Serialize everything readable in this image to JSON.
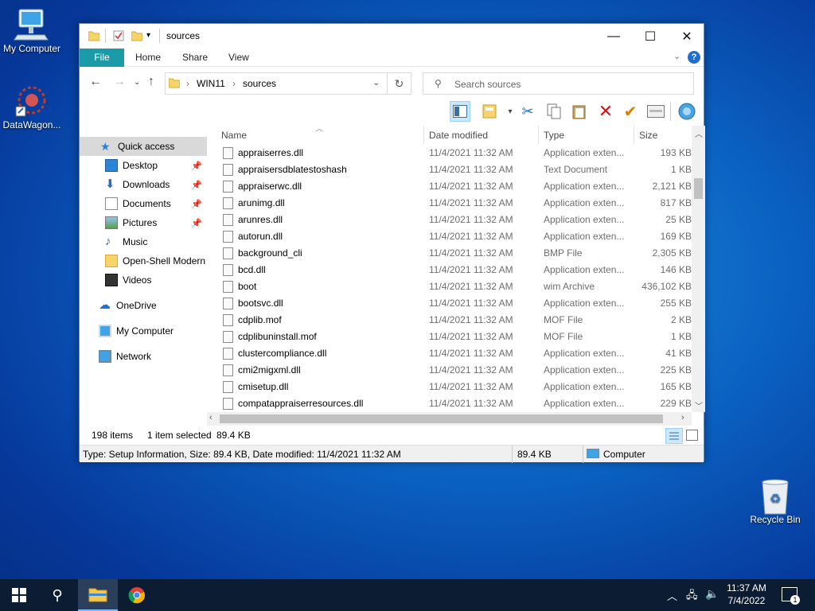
{
  "desktop": {
    "icons": [
      {
        "label": "My Computer"
      },
      {
        "label": "DataWagon..."
      },
      {
        "label": "Recycle Bin"
      }
    ]
  },
  "window": {
    "title": "sources",
    "ribbon_tabs": [
      "File",
      "Home",
      "Share",
      "View"
    ],
    "address": {
      "segments": [
        "WIN11",
        "sources"
      ]
    },
    "search": {
      "placeholder": "Search sources"
    },
    "nav": {
      "quick_access": "Quick access",
      "items": [
        {
          "label": "Desktop",
          "pinned": true
        },
        {
          "label": "Downloads",
          "pinned": true
        },
        {
          "label": "Documents",
          "pinned": true
        },
        {
          "label": "Pictures",
          "pinned": true
        },
        {
          "label": "Music",
          "pinned": false
        },
        {
          "label": "Open-Shell Modern",
          "pinned": false
        },
        {
          "label": "Videos",
          "pinned": false
        }
      ],
      "onedrive": "OneDrive",
      "mycomputer": "My Computer",
      "network": "Network"
    },
    "columns": [
      "Name",
      "Date modified",
      "Type",
      "Size"
    ],
    "files": [
      {
        "name": "appraiserres.dll",
        "date": "11/4/2021 11:32 AM",
        "type": "Application exten...",
        "size": "193 KB"
      },
      {
        "name": "appraisersdblatestoshash",
        "date": "11/4/2021 11:32 AM",
        "type": "Text Document",
        "size": "1 KB"
      },
      {
        "name": "appraiserwc.dll",
        "date": "11/4/2021 11:32 AM",
        "type": "Application exten...",
        "size": "2,121 KB"
      },
      {
        "name": "arunimg.dll",
        "date": "11/4/2021 11:32 AM",
        "type": "Application exten...",
        "size": "817 KB"
      },
      {
        "name": "arunres.dll",
        "date": "11/4/2021 11:32 AM",
        "type": "Application exten...",
        "size": "25 KB"
      },
      {
        "name": "autorun.dll",
        "date": "11/4/2021 11:32 AM",
        "type": "Application exten...",
        "size": "169 KB"
      },
      {
        "name": "background_cli",
        "date": "11/4/2021 11:32 AM",
        "type": "BMP File",
        "size": "2,305 KB"
      },
      {
        "name": "bcd.dll",
        "date": "11/4/2021 11:32 AM",
        "type": "Application exten...",
        "size": "146 KB"
      },
      {
        "name": "boot",
        "date": "11/4/2021 11:32 AM",
        "type": "wim Archive",
        "size": "436,102 KB"
      },
      {
        "name": "bootsvc.dll",
        "date": "11/4/2021 11:32 AM",
        "type": "Application exten...",
        "size": "255 KB"
      },
      {
        "name": "cdplib.mof",
        "date": "11/4/2021 11:32 AM",
        "type": "MOF File",
        "size": "2 KB"
      },
      {
        "name": "cdplibuninstall.mof",
        "date": "11/4/2021 11:32 AM",
        "type": "MOF File",
        "size": "1 KB"
      },
      {
        "name": "clustercompliance.dll",
        "date": "11/4/2021 11:32 AM",
        "type": "Application exten...",
        "size": "41 KB"
      },
      {
        "name": "cmi2migxml.dll",
        "date": "11/4/2021 11:32 AM",
        "type": "Application exten...",
        "size": "225 KB"
      },
      {
        "name": "cmisetup.dll",
        "date": "11/4/2021 11:32 AM",
        "type": "Application exten...",
        "size": "165 KB"
      },
      {
        "name": "compatappraiserresources.dll",
        "date": "11/4/2021 11:32 AM",
        "type": "Application exten...",
        "size": "229 KB"
      }
    ],
    "status": {
      "count": "198 items",
      "selected": "1 item selected",
      "selected_size": "89.4 KB"
    },
    "info": {
      "text": "Type: Setup Information, Size: 89.4 KB, Date modified: 11/4/2021 11:32 AM",
      "size": "89.4 KB",
      "location": "Computer"
    }
  },
  "taskbar": {
    "time": "11:37 AM",
    "date": "7/4/2022",
    "notification_count": "1"
  },
  "colors": {
    "file_tab": "#1b9aa8",
    "taskbar": "#0c1d33",
    "selection": "#cce8ff"
  }
}
